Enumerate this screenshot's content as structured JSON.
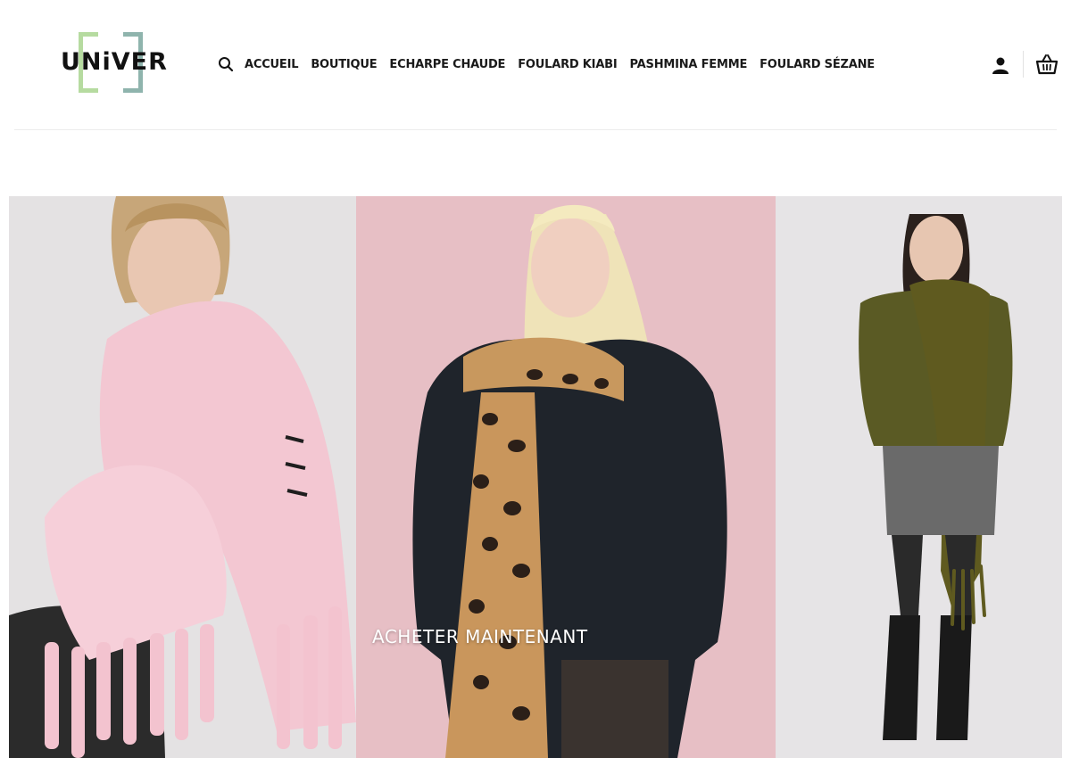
{
  "brand": {
    "logo_text": "UNiVER"
  },
  "nav": {
    "items": [
      {
        "label": "ACCUEIL"
      },
      {
        "label": "BOUTIQUE"
      },
      {
        "label": "ECHARPE CHAUDE"
      },
      {
        "label": "FOULARD KIABI"
      },
      {
        "label": "PASHMINA FEMME"
      },
      {
        "label": "FOULARD SÉZANE"
      }
    ]
  },
  "header_icons": [
    "search-icon",
    "account-icon",
    "basket-icon"
  ],
  "banner": {
    "cta_label": "ACHETER MAINTENANT",
    "panels": [
      {
        "subject": "pink-scarf-model"
      },
      {
        "subject": "leopard-scarf-model"
      },
      {
        "subject": "olive-scarf-model"
      }
    ]
  },
  "colors": {
    "text": "#1a1a1a",
    "logo_bracket_left": "#b6dba0",
    "logo_bracket_right": "#8fb4ad",
    "panel_1_bg": "#e4e2e3",
    "panel_2_bg": "#e7bfc5",
    "panel_3_bg": "#e6e4e6"
  }
}
